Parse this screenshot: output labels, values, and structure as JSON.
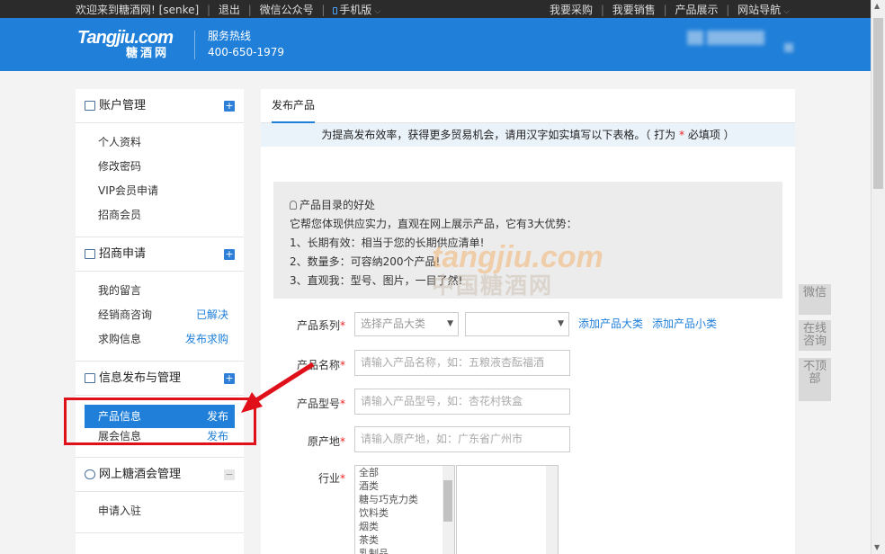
{
  "topbar": {
    "welcome": "欢迎来到糖酒网!",
    "user": "[senke]",
    "logout": "退出",
    "wechat": "微信公众号",
    "mobile": "手机版",
    "buy": "我要采购",
    "sell": "我要销售",
    "products": "产品展示",
    "nav": "网站导航"
  },
  "header": {
    "logo_en": "Tangjiu.com",
    "logo_cn": "糖酒网",
    "hotline_label": "服务热线",
    "hotline_number": "400-650-1979"
  },
  "sidebar": {
    "sections": [
      {
        "title": "账户管理",
        "toggle": "+",
        "items": [
          {
            "label": "个人资料",
            "action": ""
          },
          {
            "label": "修改密码",
            "action": ""
          },
          {
            "label": "VIP会员申请",
            "action": ""
          },
          {
            "label": "招商会员",
            "action": ""
          }
        ]
      },
      {
        "title": "招商申请",
        "toggle": "+",
        "items": [
          {
            "label": "我的留言",
            "action": ""
          },
          {
            "label": "经销商咨询",
            "action": "已解决"
          },
          {
            "label": "求购信息",
            "action": "发布求购"
          }
        ]
      },
      {
        "title": "信息发布与管理",
        "toggle": "+",
        "items": [
          {
            "label": "产品信息",
            "action": "发布"
          },
          {
            "label": "展会信息",
            "action": "发布"
          }
        ]
      },
      {
        "title": "网上糖酒会管理",
        "toggle": "−",
        "items": [
          {
            "label": "申请入驻",
            "action": ""
          }
        ]
      }
    ]
  },
  "main": {
    "tab": "发布产品",
    "notice_pre": "为提高发布效率，获得更多贸易机会，请用汉字如实填写以下表格。（ 打为 ",
    "notice_star": "*",
    "notice_post": " 必填项 ）",
    "info": {
      "title": "产品目录的好处",
      "line1": "它帮您体现供应实力，直观在网上展示产品，它有3大优势：",
      "line2": "1、长期有效：相当于您的长期供应清单!",
      "line3": "2、数量多：可容纳200个产品!",
      "line4": "3、直观我：型号、图片，一目了然!"
    },
    "watermark_en": "tangjiu.com",
    "watermark_cn": "中国糖酒网",
    "form": {
      "series_label": "产品系列",
      "series_placeholder": "选择产品大类",
      "add_big": "添加产品大类",
      "add_small": "添加产品小类",
      "name_label": "产品名称",
      "name_placeholder": "请输入产品名称，如：五粮液杏酝福酒",
      "model_label": "产品型号",
      "model_placeholder": "请输入产品型号，如：杏花村铁盒",
      "origin_label": "原产地",
      "origin_placeholder": "请输入原产地，如：广东省广州市",
      "industry_label": "行业",
      "industry_options": [
        "全部",
        "酒类",
        "糖与巧克力类",
        "饮料类",
        "烟类",
        "茶类",
        "乳制品"
      ],
      "required_mark": "*"
    }
  },
  "float_tools": {
    "wechat": "微信",
    "online": "在线咨询",
    "top": "不顶部"
  }
}
